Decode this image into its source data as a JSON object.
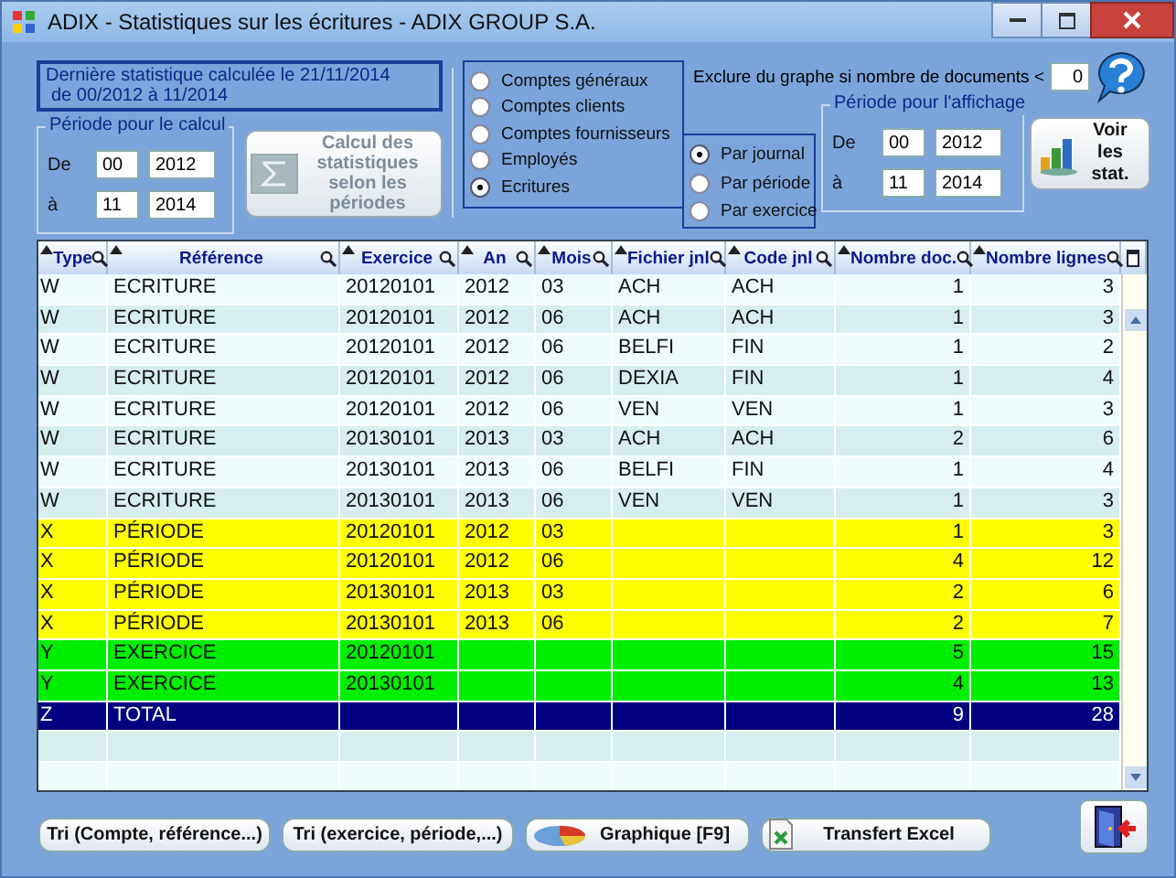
{
  "window": {
    "title": "ADIX - Statistiques sur les écritures - ADIX GROUP S.A."
  },
  "info": {
    "lines": [
      "Dernière statistique calculée le 21/11/2014",
      "de 00/2012 à 11/2014"
    ]
  },
  "calc_period": {
    "title": "Période pour le calcul",
    "from_label": "De",
    "from_month": "00",
    "from_year": "2012",
    "to_label": "à",
    "to_month": "11",
    "to_year": "2014"
  },
  "calc_button": {
    "label": "Calcul des statistiques selon les périodes",
    "disabled": true
  },
  "account_types": [
    {
      "label": "Comptes généraux",
      "selected": false
    },
    {
      "label": "Comptes clients",
      "selected": false
    },
    {
      "label": "Comptes fournisseurs",
      "selected": false
    },
    {
      "label": "Employés",
      "selected": false
    },
    {
      "label": "Ecritures",
      "selected": true
    }
  ],
  "grouping": [
    {
      "label": "Par journal",
      "selected": true
    },
    {
      "label": "Par période",
      "selected": false
    },
    {
      "label": "Par exercice",
      "selected": false
    }
  ],
  "exclude": {
    "label": "Exclure du graphe si nombre de documents <",
    "value": "0"
  },
  "display_period": {
    "title": "Période pour l'affichage",
    "from_label": "De",
    "from_month": "00",
    "from_year": "2012",
    "to_label": "à",
    "to_month": "11",
    "to_year": "2014"
  },
  "view_button": {
    "label": "Voir les stat."
  },
  "table": {
    "columns": [
      {
        "label": "Type"
      },
      {
        "label": "Référence"
      },
      {
        "label": "Exercice"
      },
      {
        "label": "An"
      },
      {
        "label": "Mois"
      },
      {
        "label": "Fichier jnl"
      },
      {
        "label": "Code jnl"
      },
      {
        "label": "Nombre doc."
      },
      {
        "label": "Nombre lignes"
      }
    ],
    "rows": [
      {
        "kind": "detail",
        "cells": [
          "W",
          "ECRITURE",
          "20120101",
          "2012",
          "03",
          "ACH",
          "ACH",
          "1",
          "3"
        ]
      },
      {
        "kind": "detail",
        "cells": [
          "W",
          "ECRITURE",
          "20120101",
          "2012",
          "06",
          "ACH",
          "ACH",
          "1",
          "3"
        ]
      },
      {
        "kind": "detail",
        "cells": [
          "W",
          "ECRITURE",
          "20120101",
          "2012",
          "06",
          "BELFI",
          "FIN",
          "1",
          "2"
        ]
      },
      {
        "kind": "detail",
        "cells": [
          "W",
          "ECRITURE",
          "20120101",
          "2012",
          "06",
          "DEXIA",
          "FIN",
          "1",
          "4"
        ]
      },
      {
        "kind": "detail",
        "cells": [
          "W",
          "ECRITURE",
          "20120101",
          "2012",
          "06",
          "VEN",
          "VEN",
          "1",
          "3"
        ]
      },
      {
        "kind": "detail",
        "cells": [
          "W",
          "ECRITURE",
          "20130101",
          "2013",
          "03",
          "ACH",
          "ACH",
          "2",
          "6"
        ]
      },
      {
        "kind": "detail",
        "cells": [
          "W",
          "ECRITURE",
          "20130101",
          "2013",
          "06",
          "BELFI",
          "FIN",
          "1",
          "4"
        ]
      },
      {
        "kind": "detail",
        "cells": [
          "W",
          "ECRITURE",
          "20130101",
          "2013",
          "06",
          "VEN",
          "VEN",
          "1",
          "3"
        ]
      },
      {
        "kind": "period",
        "cells": [
          "X",
          "PÉRIODE",
          "20120101",
          "2012",
          "03",
          "",
          "",
          "1",
          "3"
        ]
      },
      {
        "kind": "period",
        "cells": [
          "X",
          "PÉRIODE",
          "20120101",
          "2012",
          "06",
          "",
          "",
          "4",
          "12"
        ]
      },
      {
        "kind": "period",
        "cells": [
          "X",
          "PÉRIODE",
          "20130101",
          "2013",
          "03",
          "",
          "",
          "2",
          "6"
        ]
      },
      {
        "kind": "period",
        "cells": [
          "X",
          "PÉRIODE",
          "20130101",
          "2013",
          "06",
          "",
          "",
          "2",
          "7"
        ]
      },
      {
        "kind": "year",
        "cells": [
          "Y",
          "EXERCICE",
          "20120101",
          "",
          "",
          "",
          "",
          "5",
          "15"
        ]
      },
      {
        "kind": "year",
        "cells": [
          "Y",
          "EXERCICE",
          "20130101",
          "",
          "",
          "",
          "",
          "4",
          "13"
        ]
      },
      {
        "kind": "total",
        "cells": [
          "Z",
          "TOTAL",
          "",
          "",
          "",
          "",
          "",
          "9",
          "28"
        ]
      }
    ]
  },
  "buttons": [
    {
      "label": "Tri (Compte, référence...)"
    },
    {
      "label": "Tri (exercice, période,...)"
    },
    {
      "label": "Graphique [F9]"
    },
    {
      "label": "Transfert Excel"
    }
  ]
}
